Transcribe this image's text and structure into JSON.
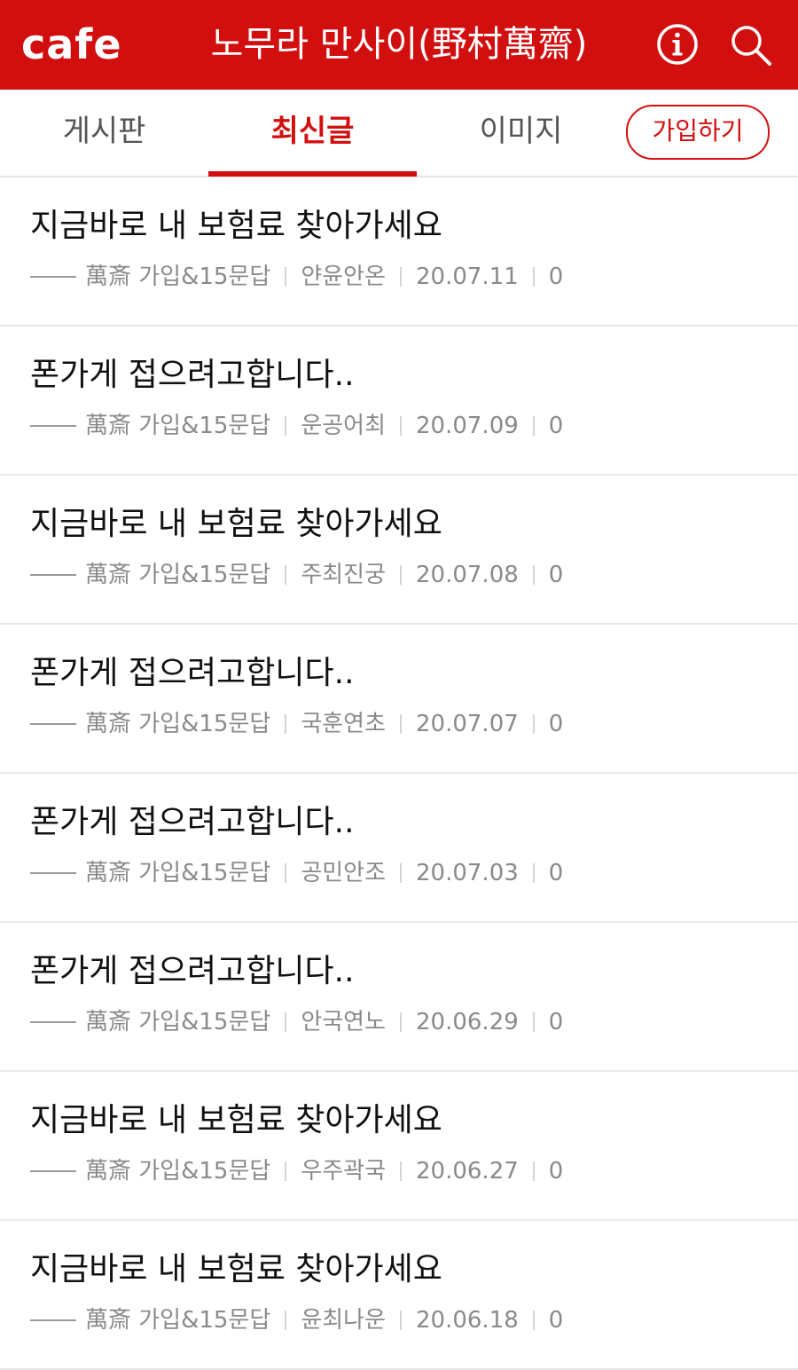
{
  "header": {
    "logo": "cafe",
    "title": "노무라 만사이(野村萬齋)",
    "info_icon": "info-icon",
    "search_icon": "search-icon",
    "color": "#d20f0f"
  },
  "tabs": [
    {
      "label": "게시판"
    },
    {
      "label": "최신글"
    },
    {
      "label": "이미지"
    }
  ],
  "join_label": "가입하기",
  "posts": [
    {
      "title": "지금바로 내 보험료 찾아가세요",
      "board": "萬斎 가입&15문답",
      "author": "얀윤안온",
      "date": "20.07.11",
      "count": "0"
    },
    {
      "title": "폰가게 접으려고합니다..",
      "board": "萬斎 가입&15문답",
      "author": "운공어최",
      "date": "20.07.09",
      "count": "0"
    },
    {
      "title": "지금바로 내 보험료 찾아가세요",
      "board": "萬斎 가입&15문답",
      "author": "주최진궁",
      "date": "20.07.08",
      "count": "0"
    },
    {
      "title": "폰가게 접으려고합니다..",
      "board": "萬斎 가입&15문답",
      "author": "국훈연초",
      "date": "20.07.07",
      "count": "0"
    },
    {
      "title": "폰가게 접으려고합니다..",
      "board": "萬斎 가입&15문답",
      "author": "공민안조",
      "date": "20.07.03",
      "count": "0"
    },
    {
      "title": "폰가게 접으려고합니다..",
      "board": "萬斎 가입&15문답",
      "author": "안국연노",
      "date": "20.06.29",
      "count": "0"
    },
    {
      "title": "지금바로 내 보험료 찾아가세요",
      "board": "萬斎 가입&15문답",
      "author": "우주곽국",
      "date": "20.06.27",
      "count": "0"
    },
    {
      "title": "지금바로 내 보험료 찾아가세요",
      "board": "萬斎 가입&15문답",
      "author": "윤최나운",
      "date": "20.06.18",
      "count": "0"
    }
  ]
}
